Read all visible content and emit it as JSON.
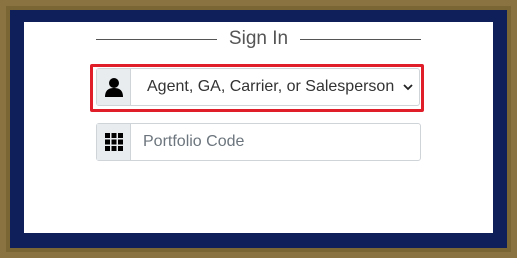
{
  "form": {
    "title": "Sign In",
    "role_select": {
      "icon": "user-icon",
      "selected": "Agent, GA, Carrier, or Salesperson"
    },
    "portfolio_code": {
      "icon": "grid-icon",
      "placeholder": "Portfolio Code",
      "value": ""
    }
  },
  "colors": {
    "frame_gold": "#8a7340",
    "frame_navy": "#0f1f5a",
    "highlight_red": "#e01e2a"
  }
}
